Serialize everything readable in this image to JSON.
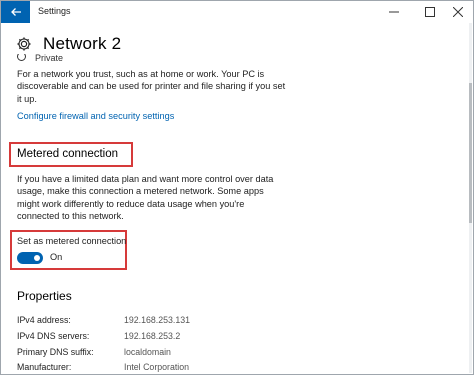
{
  "window": {
    "title": "Settings",
    "controls": {
      "minimize_icon": "minimize-icon",
      "maximize_icon": "maximize-icon",
      "close_icon": "close-icon"
    },
    "accent_color": "#0063b1"
  },
  "header": {
    "icon": "gear-icon",
    "title": "Network  2"
  },
  "private_option": {
    "label": "Private"
  },
  "private_description": "For a network you trust, such as at home or work. Your PC is discoverable and can be used for printer and file sharing if you set it up.",
  "firewall_link": "Configure firewall and security settings",
  "metered": {
    "heading": "Metered connection",
    "description": "If you have a limited data plan and want more control over data usage, make this connection a metered network. Some apps might work differently to reduce data usage when you're connected to this network.",
    "toggle_label": "Set as metered connection",
    "toggle_state": "On",
    "toggle_on": true
  },
  "properties": {
    "heading": "Properties",
    "rows": [
      {
        "key": "IPv4 address:",
        "value": "192.168.253.131"
      },
      {
        "key": "IPv4 DNS servers:",
        "value": "192.168.253.2"
      },
      {
        "key": "Primary DNS suffix:",
        "value": "localdomain"
      },
      {
        "key": "Manufacturer:",
        "value": "Intel Corporation"
      }
    ]
  },
  "highlight_color": "#d63a3a"
}
